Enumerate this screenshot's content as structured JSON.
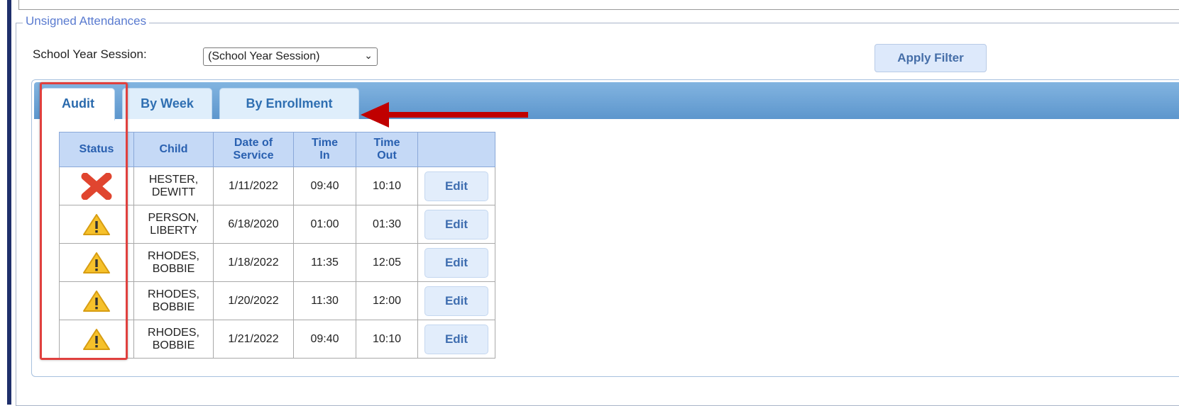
{
  "fieldset": {
    "legend": "Unsigned Attendances"
  },
  "filter": {
    "label": "School Year Session:",
    "select_value": "(School Year Session)",
    "apply_label": "Apply Filter"
  },
  "tabs": [
    {
      "label": "Audit",
      "active": true
    },
    {
      "label": "By Week",
      "active": false
    },
    {
      "label": "By Enrollment",
      "active": false
    }
  ],
  "table": {
    "headers": {
      "status": "Status",
      "child": "Child",
      "date_line1": "Date of",
      "date_line2": "Service",
      "in_line1": "Time",
      "in_line2": "In",
      "out_line1": "Time",
      "out_line2": "Out"
    },
    "rows": [
      {
        "status": "x-icon",
        "child_line1": "HESTER,",
        "child_line2": "DEWITT",
        "date": "1/11/2022",
        "time_in": "09:40",
        "time_out": "10:10",
        "action": "Edit"
      },
      {
        "status": "warning-icon",
        "child_line1": "PERSON,",
        "child_line2": "LIBERTY",
        "date": "6/18/2020",
        "time_in": "01:00",
        "time_out": "01:30",
        "action": "Edit"
      },
      {
        "status": "warning-icon",
        "child_line1": "RHODES,",
        "child_line2": "BOBBIE",
        "date": "1/18/2022",
        "time_in": "11:35",
        "time_out": "12:05",
        "action": "Edit"
      },
      {
        "status": "warning-icon",
        "child_line1": "RHODES,",
        "child_line2": "BOBBIE",
        "date": "1/20/2022",
        "time_in": "11:30",
        "time_out": "12:00",
        "action": "Edit"
      },
      {
        "status": "warning-icon",
        "child_line1": "RHODES,",
        "child_line2": "BOBBIE",
        "date": "1/21/2022",
        "time_in": "09:40",
        "time_out": "10:10",
        "action": "Edit"
      }
    ]
  },
  "annotation": {
    "highlight_color": "#e0403e",
    "arrow_color": "#c00000"
  }
}
